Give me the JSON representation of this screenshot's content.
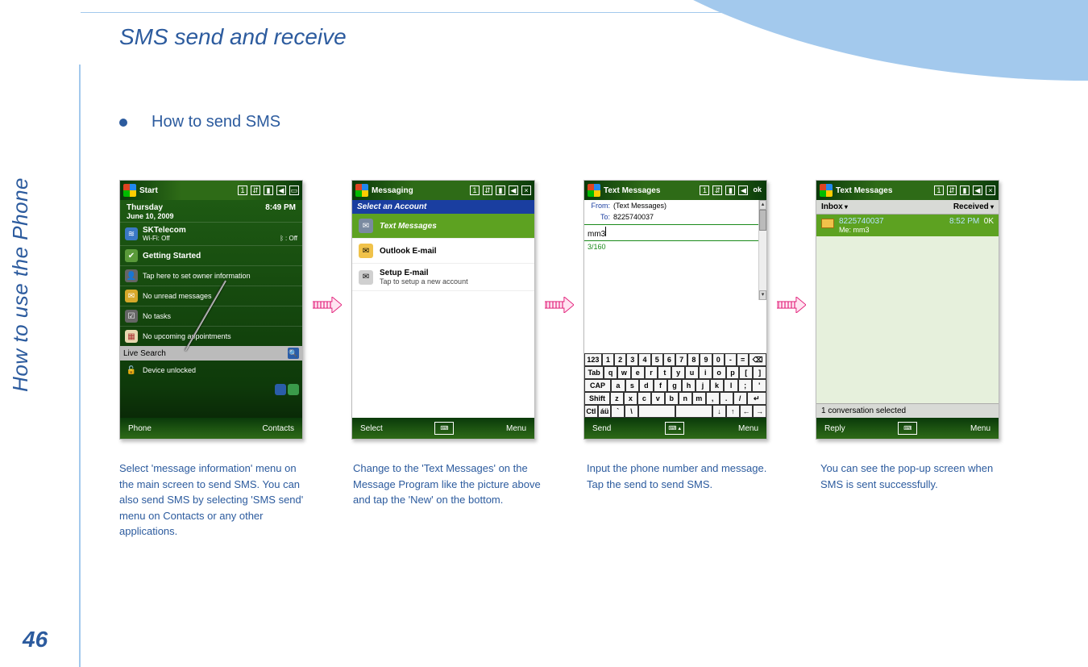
{
  "page": {
    "title": "SMS send and receive",
    "side_label": "How to use the Phone",
    "page_number": "46",
    "bullet": "How to send SMS"
  },
  "captions": [
    "Select 'message information' menu on the main screen to send SMS. You can also send SMS by selecting 'SMS send' menu on Contacts or any other applications.",
    "Change to the 'Text Messages' on the Message Program like the picture above and tap the 'New' on the bottom.",
    "Input the phone number and message. Tap the send to send SMS.",
    "You can see the pop-up screen when SMS is sent successfully."
  ],
  "screen1": {
    "title": "Start",
    "clock": "8:49 PM",
    "day": "Thursday",
    "date": "June 10, 2009",
    "carrier": "SKTelecom",
    "wifi": "Wi-Fi: Off",
    "bt": ": Off",
    "getting_started": "Getting Started",
    "tap_here": "Tap here to set owner information",
    "no_unread": "No unread messages",
    "no_tasks": "No tasks",
    "no_appt": "No upcoming appointments",
    "live_search": "Live Search",
    "device_unlocked": "Device unlocked",
    "soft_left": "Phone",
    "soft_right": "Contacts"
  },
  "screen2": {
    "title": "Messaging",
    "select_account": "Select an Account",
    "item1": "Text Messages",
    "item2": "Outlook E-mail",
    "item3": "Setup E-mail",
    "item3_sub": "Tap to setup a new account",
    "soft_left": "Select",
    "soft_right": "Menu"
  },
  "screen3": {
    "title": "Text Messages",
    "ok": "ok",
    "from_label": "From:",
    "from_value": "(Text Messages)",
    "to_label": "To:",
    "to_value": "8225740037",
    "msg_value": "mm3",
    "counter": "3/160",
    "soft_left": "Send",
    "soft_right": "Menu",
    "kb_rows": [
      [
        "123",
        "1",
        "2",
        "3",
        "4",
        "5",
        "6",
        "7",
        "8",
        "9",
        "0",
        "-",
        "=",
        "⌫"
      ],
      [
        "Tab",
        "q",
        "w",
        "e",
        "r",
        "t",
        "y",
        "u",
        "i",
        "o",
        "p",
        "[",
        "]"
      ],
      [
        "CAP",
        "a",
        "s",
        "d",
        "f",
        "g",
        "h",
        "j",
        "k",
        "l",
        ";",
        "'"
      ],
      [
        "Shift",
        "z",
        "x",
        "c",
        "v",
        "b",
        "n",
        "m",
        ",",
        ".",
        "/",
        "↵"
      ],
      [
        "Ctl",
        "áü",
        "`",
        "\\",
        " ",
        " ",
        "↓",
        "↑",
        "←",
        "→"
      ]
    ]
  },
  "screen4": {
    "title": "Text Messages",
    "close": "×",
    "folder": "Inbox",
    "sort": "Received",
    "msg_from": "8225740037",
    "msg_time": "8:52 PM",
    "msg_ok": "0K",
    "msg_sub": "Me: mm3",
    "status": "1 conversation selected",
    "soft_left": "Reply",
    "soft_right": "Menu"
  }
}
